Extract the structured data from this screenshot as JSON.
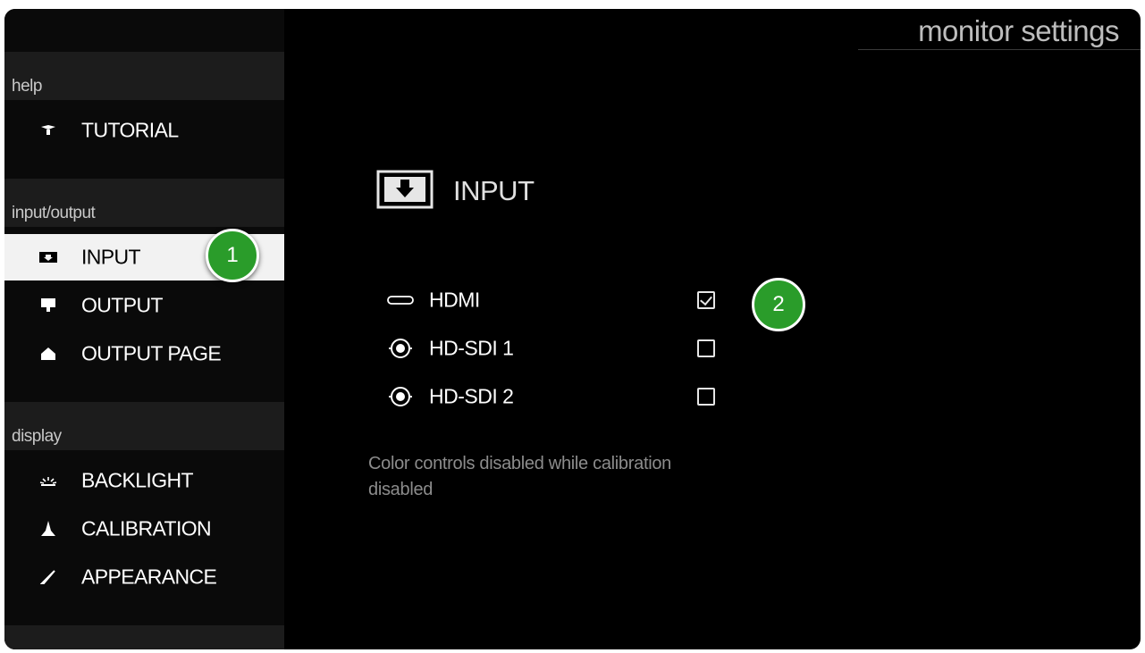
{
  "app": {
    "title": "monitor settings"
  },
  "sidebar": {
    "sections": [
      {
        "header": "help",
        "items": [
          {
            "label": "TUTORIAL",
            "icon": "tutorial-icon"
          }
        ]
      },
      {
        "header": "input/output",
        "items": [
          {
            "label": "INPUT",
            "icon": "input-icon",
            "selected": true
          },
          {
            "label": "OUTPUT",
            "icon": "output-icon"
          },
          {
            "label": "OUTPUT PAGE",
            "icon": "output-page-icon"
          }
        ]
      },
      {
        "header": "display",
        "items": [
          {
            "label": "BACKLIGHT",
            "icon": "backlight-icon"
          },
          {
            "label": "CALIBRATION",
            "icon": "calibration-icon"
          },
          {
            "label": "APPEARANCE",
            "icon": "appearance-icon"
          }
        ]
      }
    ]
  },
  "panel": {
    "title": "INPUT",
    "icon": "input-panel-icon",
    "inputs": [
      {
        "label": "HDMI",
        "icon": "hdmi-port-icon",
        "checked": true
      },
      {
        "label": "HD-SDI 1",
        "icon": "sdi-port-icon",
        "checked": false
      },
      {
        "label": "HD-SDI 2",
        "icon": "sdi-port-icon",
        "checked": false
      }
    ],
    "note": "Color controls disabled while calibration disabled"
  },
  "annotations": {
    "badge_1": "1",
    "badge_2": "2",
    "color": "#2a9c2a"
  }
}
